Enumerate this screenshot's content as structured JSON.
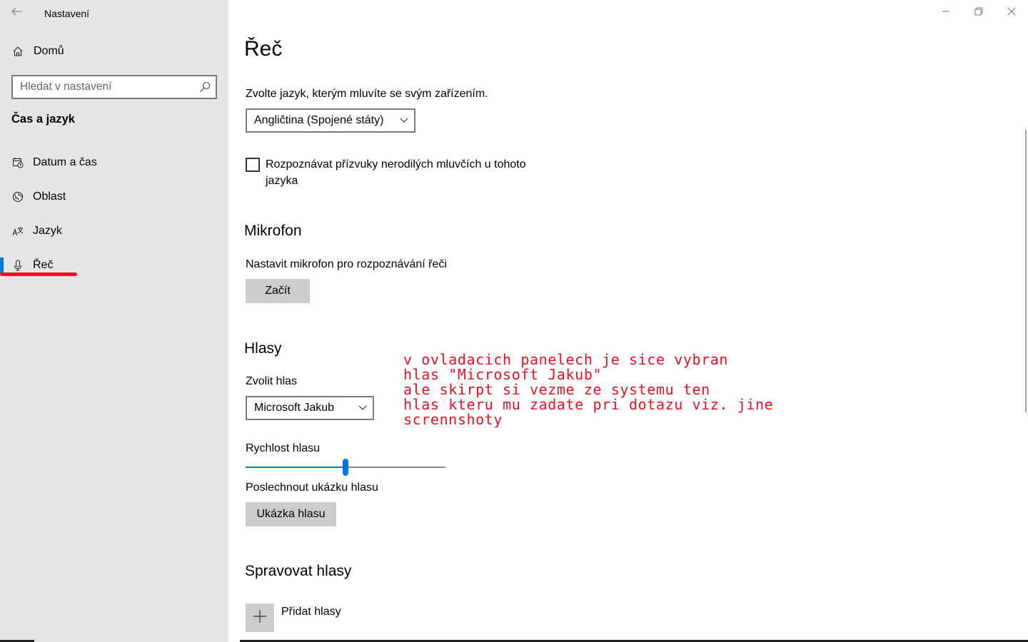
{
  "sidebar": {
    "app_title": "Nastavení",
    "home_label": "Domů",
    "search_placeholder": "Hledat v nastavení",
    "section_title": "Čas a jazyk",
    "items": [
      {
        "label": "Datum a čas",
        "icon": "calendar-clock-icon"
      },
      {
        "label": "Oblast",
        "icon": "globe-icon"
      },
      {
        "label": "Jazyk",
        "icon": "language-icon"
      },
      {
        "label": "Řeč",
        "icon": "microphone-icon",
        "active": true
      }
    ]
  },
  "main": {
    "title": "Řeč",
    "language_prompt": "Zvolte jazyk, kterým mluvíte se svým zařízením.",
    "language_value": "Angličtina (Spojené státy)",
    "accent_checkbox_label_line1": "Rozpoznávat přízvuky nerodilých mluvčích u tohoto",
    "accent_checkbox_label_line2": "jazyka",
    "accent_checked": false,
    "microphone": {
      "heading": "Mikrofon",
      "prompt": "Nastavit mikrofon pro rozpoznávání řeči",
      "button": "Začít"
    },
    "voices": {
      "heading": "Hlasy",
      "choose_label": "Zvolit hlas",
      "voice_value": "Microsoft Jakub",
      "speed_label": "Rychlost hlasu",
      "speed_fraction": 0.5,
      "preview_label": "Poslechnout ukázku hlasu",
      "preview_button": "Ukázka hlasu"
    },
    "manage": {
      "heading": "Spravovat hlasy",
      "add_label": "Přidat hlasy"
    }
  },
  "annotation": {
    "line1": "v ovladacich panelech je sice vybran",
    "line2": "hlas \"Microsoft Jakub\"",
    "line3": "ale skirpt si vezme ze systemu ten",
    "line4": "hlas kteru mu zadate pri dotazu viz. jine",
    "line5": "scrennshoty",
    "color": "#e81123"
  },
  "colors": {
    "accent": "#0078d7",
    "sidebar_bg": "#e6e6e6",
    "button_bg": "#cccccc"
  }
}
